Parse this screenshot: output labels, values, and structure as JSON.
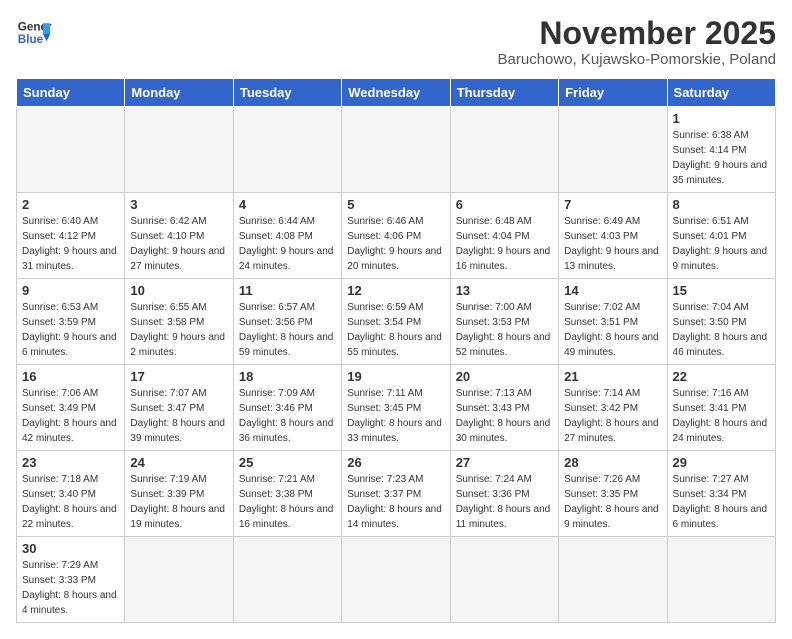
{
  "header": {
    "logo_line1": "General",
    "logo_line2": "Blue",
    "month": "November 2025",
    "location": "Baruchowo, Kujawsko-Pomorskie, Poland"
  },
  "weekdays": [
    "Sunday",
    "Monday",
    "Tuesday",
    "Wednesday",
    "Thursday",
    "Friday",
    "Saturday"
  ],
  "days": {
    "1": {
      "sunrise": "6:38 AM",
      "sunset": "4:14 PM",
      "daylight": "9 hours and 35 minutes."
    },
    "2": {
      "sunrise": "6:40 AM",
      "sunset": "4:12 PM",
      "daylight": "9 hours and 31 minutes."
    },
    "3": {
      "sunrise": "6:42 AM",
      "sunset": "4:10 PM",
      "daylight": "9 hours and 27 minutes."
    },
    "4": {
      "sunrise": "6:44 AM",
      "sunset": "4:08 PM",
      "daylight": "9 hours and 24 minutes."
    },
    "5": {
      "sunrise": "6:46 AM",
      "sunset": "4:06 PM",
      "daylight": "9 hours and 20 minutes."
    },
    "6": {
      "sunrise": "6:48 AM",
      "sunset": "4:04 PM",
      "daylight": "9 hours and 16 minutes."
    },
    "7": {
      "sunrise": "6:49 AM",
      "sunset": "4:03 PM",
      "daylight": "9 hours and 13 minutes."
    },
    "8": {
      "sunrise": "6:51 AM",
      "sunset": "4:01 PM",
      "daylight": "9 hours and 9 minutes."
    },
    "9": {
      "sunrise": "6:53 AM",
      "sunset": "3:59 PM",
      "daylight": "9 hours and 6 minutes."
    },
    "10": {
      "sunrise": "6:55 AM",
      "sunset": "3:58 PM",
      "daylight": "9 hours and 2 minutes."
    },
    "11": {
      "sunrise": "6:57 AM",
      "sunset": "3:56 PM",
      "daylight": "8 hours and 59 minutes."
    },
    "12": {
      "sunrise": "6:59 AM",
      "sunset": "3:54 PM",
      "daylight": "8 hours and 55 minutes."
    },
    "13": {
      "sunrise": "7:00 AM",
      "sunset": "3:53 PM",
      "daylight": "8 hours and 52 minutes."
    },
    "14": {
      "sunrise": "7:02 AM",
      "sunset": "3:51 PM",
      "daylight": "8 hours and 49 minutes."
    },
    "15": {
      "sunrise": "7:04 AM",
      "sunset": "3:50 PM",
      "daylight": "8 hours and 46 minutes."
    },
    "16": {
      "sunrise": "7:06 AM",
      "sunset": "3:49 PM",
      "daylight": "8 hours and 42 minutes."
    },
    "17": {
      "sunrise": "7:07 AM",
      "sunset": "3:47 PM",
      "daylight": "8 hours and 39 minutes."
    },
    "18": {
      "sunrise": "7:09 AM",
      "sunset": "3:46 PM",
      "daylight": "8 hours and 36 minutes."
    },
    "19": {
      "sunrise": "7:11 AM",
      "sunset": "3:45 PM",
      "daylight": "8 hours and 33 minutes."
    },
    "20": {
      "sunrise": "7:13 AM",
      "sunset": "3:43 PM",
      "daylight": "8 hours and 30 minutes."
    },
    "21": {
      "sunrise": "7:14 AM",
      "sunset": "3:42 PM",
      "daylight": "8 hours and 27 minutes."
    },
    "22": {
      "sunrise": "7:16 AM",
      "sunset": "3:41 PM",
      "daylight": "8 hours and 24 minutes."
    },
    "23": {
      "sunrise": "7:18 AM",
      "sunset": "3:40 PM",
      "daylight": "8 hours and 22 minutes."
    },
    "24": {
      "sunrise": "7:19 AM",
      "sunset": "3:39 PM",
      "daylight": "8 hours and 19 minutes."
    },
    "25": {
      "sunrise": "7:21 AM",
      "sunset": "3:38 PM",
      "daylight": "8 hours and 16 minutes."
    },
    "26": {
      "sunrise": "7:23 AM",
      "sunset": "3:37 PM",
      "daylight": "8 hours and 14 minutes."
    },
    "27": {
      "sunrise": "7:24 AM",
      "sunset": "3:36 PM",
      "daylight": "8 hours and 11 minutes."
    },
    "28": {
      "sunrise": "7:26 AM",
      "sunset": "3:35 PM",
      "daylight": "8 hours and 9 minutes."
    },
    "29": {
      "sunrise": "7:27 AM",
      "sunset": "3:34 PM",
      "daylight": "8 hours and 6 minutes."
    },
    "30": {
      "sunrise": "7:29 AM",
      "sunset": "3:33 PM",
      "daylight": "8 hours and 4 minutes."
    }
  }
}
